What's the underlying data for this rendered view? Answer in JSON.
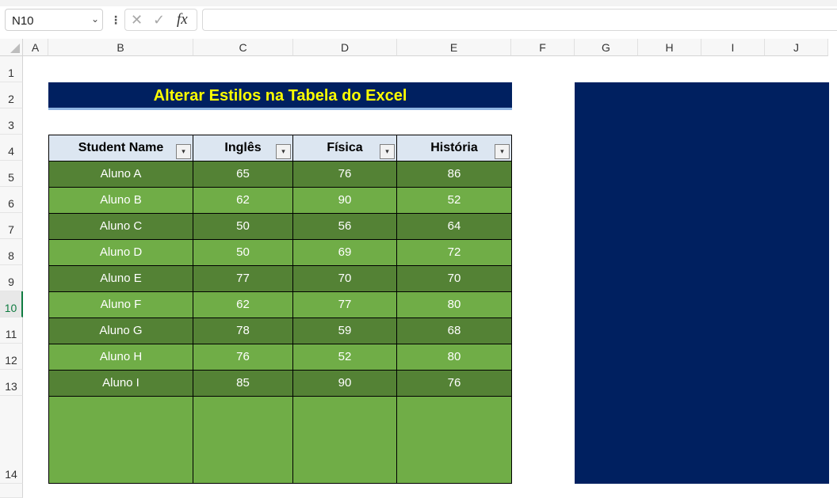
{
  "formula_bar": {
    "name_box": "N10",
    "name_box_chevron": "chevron-down-icon",
    "more_icon": "⋮",
    "cancel_icon": "✕",
    "enter_icon": "✓",
    "fx_label": "fx",
    "formula_value": ""
  },
  "columns": [
    "A",
    "B",
    "C",
    "D",
    "E",
    "F",
    "G",
    "H",
    "I",
    "J"
  ],
  "rows": [
    "1",
    "2",
    "3",
    "4",
    "5",
    "6",
    "7",
    "8",
    "9",
    "10",
    "11",
    "12",
    "13",
    "14"
  ],
  "active_row": "10",
  "sheet": {
    "title": "Alterar Estilos na Tabela do Excel",
    "table": {
      "headers": [
        "Student Name",
        "Inglês",
        "Física",
        "História"
      ],
      "filter_icon": "▾",
      "rows": [
        [
          "Aluno A",
          "65",
          "76",
          "86"
        ],
        [
          "Aluno B",
          "62",
          "90",
          "52"
        ],
        [
          "Aluno C",
          "50",
          "56",
          "64"
        ],
        [
          "Aluno D",
          "50",
          "69",
          "72"
        ],
        [
          "Aluno E",
          "77",
          "70",
          "70"
        ],
        [
          "Aluno F",
          "62",
          "77",
          "80"
        ],
        [
          "Aluno G",
          "78",
          "59",
          "68"
        ],
        [
          "Aluno H",
          "76",
          "52",
          "80"
        ],
        [
          "Aluno I",
          "85",
          "90",
          "76"
        ]
      ]
    }
  },
  "colors": {
    "title_bg": "#002060",
    "title_text": "#ffff00",
    "header_bg": "#dce6f1",
    "row_dark": "#548235",
    "row_light": "#70ad47",
    "panel_bg": "#002060",
    "active_row_accent": "#107c41"
  }
}
